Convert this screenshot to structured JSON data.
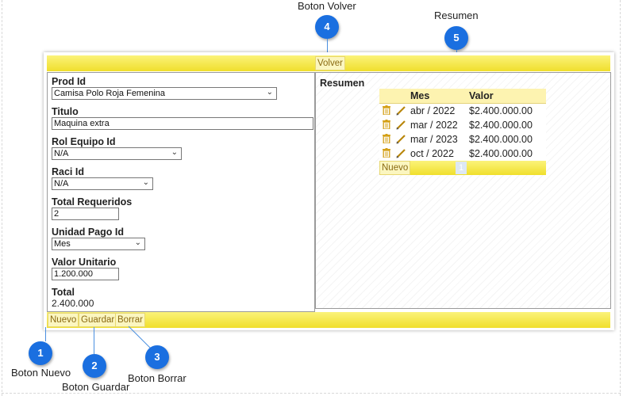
{
  "annotations": {
    "volver": {
      "number": "4",
      "label": "Boton Volver"
    },
    "resumen": {
      "number": "5",
      "label": "Resumen"
    },
    "nuevo": {
      "number": "1",
      "label": "Boton Nuevo"
    },
    "guardar": {
      "number": "2",
      "label": "Boton Guardar"
    },
    "borrar": {
      "number": "3",
      "label": "Boton Borrar"
    }
  },
  "toolbar": {
    "volver_label": "Volver"
  },
  "form": {
    "prod_id": {
      "label": "Prod Id",
      "value": "Camisa Polo Roja Femenina"
    },
    "titulo": {
      "label": "Titulo",
      "value": "Maquina extra"
    },
    "rol_equipo_id": {
      "label": "Rol Equipo Id",
      "value": "N/A"
    },
    "raci_id": {
      "label": "Raci Id",
      "value": "N/A"
    },
    "total_requeridos": {
      "label": "Total Requeridos",
      "value": "2"
    },
    "unidad_pago_id": {
      "label": "Unidad Pago Id",
      "value": "Mes"
    },
    "valor_unitario": {
      "label": "Valor Unitario",
      "value": "1.200.000"
    },
    "total": {
      "label": "Total",
      "value": "2.400.000"
    }
  },
  "resumen": {
    "title": "Resumen",
    "columns": [
      "Mes",
      "Valor"
    ],
    "rows": [
      {
        "mes": "abr / 2022",
        "valor": "$2.400.000.00"
      },
      {
        "mes": "mar / 2022",
        "valor": "$2.400.000.00"
      },
      {
        "mes": "mar / 2023",
        "valor": "$2.400.000.00"
      },
      {
        "mes": "oct / 2022",
        "valor": "$2.400.000.00"
      }
    ],
    "nuevo_label": "Nuevo",
    "page": "1"
  },
  "footer": {
    "nuevo_label": "Nuevo",
    "guardar_label": "Guardar",
    "borrar_label": "Borrar"
  },
  "colors": {
    "bubble": "#1a6fe0",
    "toolbar": "#f0df2c",
    "grid_header": "#fdf3b0"
  }
}
